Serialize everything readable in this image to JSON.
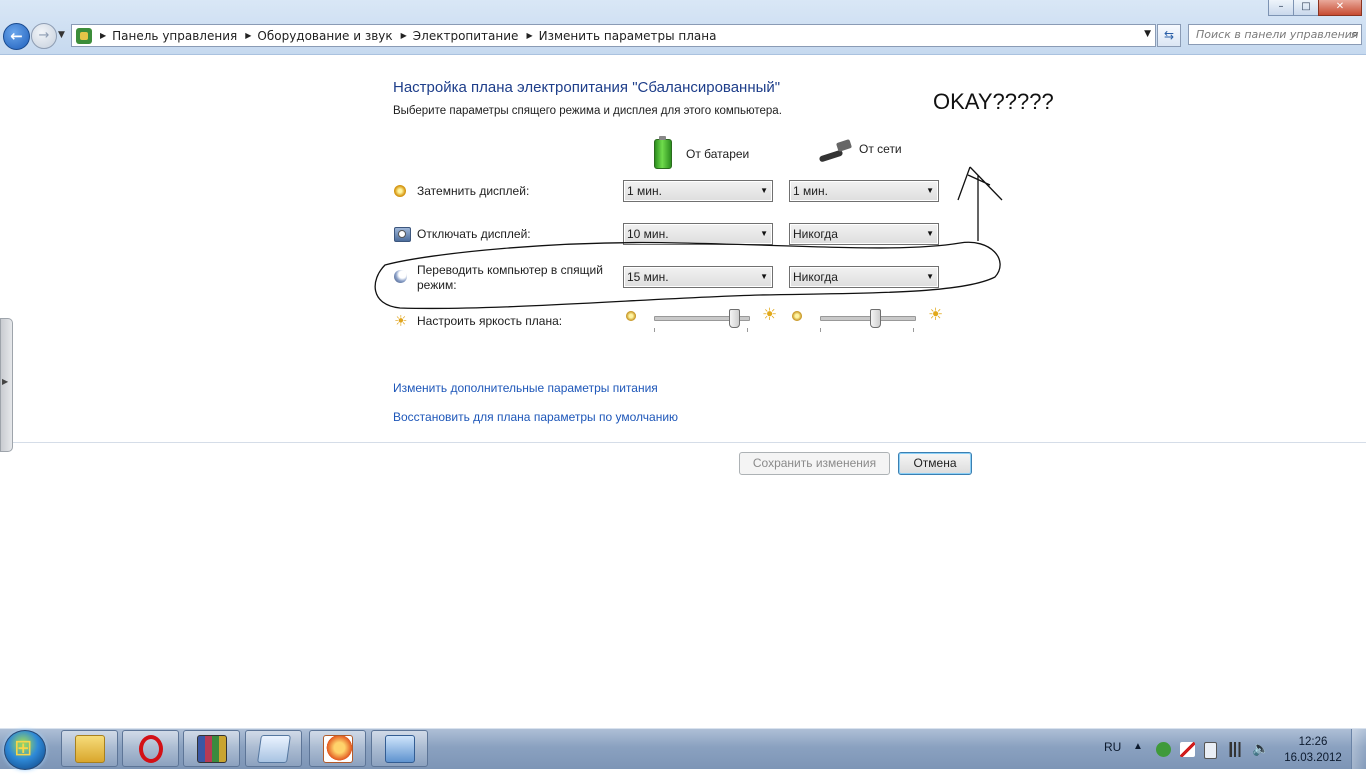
{
  "addressbar": {
    "breadcrumbs": [
      "Панель управления",
      "Оборудование и звук",
      "Электропитание",
      "Изменить параметры плана"
    ],
    "search_placeholder": "Поиск в панели управления"
  },
  "window_buttons": {
    "minimize": "–",
    "maximize": "□",
    "close": "✕"
  },
  "page": {
    "title": "Настройка плана электропитания \"Сбалансированный\"",
    "subtitle": "Выберите параметры спящего режима и дисплея для этого компьютера.",
    "col_battery": "От батареи",
    "col_power": "От сети",
    "settings": [
      {
        "label": "Затемнить дисплей:",
        "battery": "1 мин.",
        "power": "1 мин."
      },
      {
        "label": "Отключать дисплей:",
        "battery": "10 мин.",
        "power": "Никогда"
      },
      {
        "label": "Переводить компьютер в спящий режим:",
        "battery": "15 мин.",
        "power": "Никогда"
      }
    ],
    "brightness_label": "Настроить яркость плана:",
    "brightness_battery": 0.85,
    "brightness_power": 0.59,
    "link_advanced": "Изменить дополнительные параметры питания",
    "link_restore": "Восстановить для плана параметры по умолчанию",
    "save_button": "Сохранить изменения",
    "cancel_button": "Отмена",
    "annotation_text": "OKAY?????"
  },
  "taskbar": {
    "apps": [
      "explorer-icon",
      "opera-icon",
      "winrar-icon",
      "notepad-icon",
      "paint-icon",
      "control-panel-icon"
    ],
    "language": "RU",
    "time": "12:26",
    "date": "16.03.2012"
  },
  "colors": {
    "title": "#1e3e8a",
    "link": "#1e57b9",
    "accent": "#2f8ad8"
  }
}
